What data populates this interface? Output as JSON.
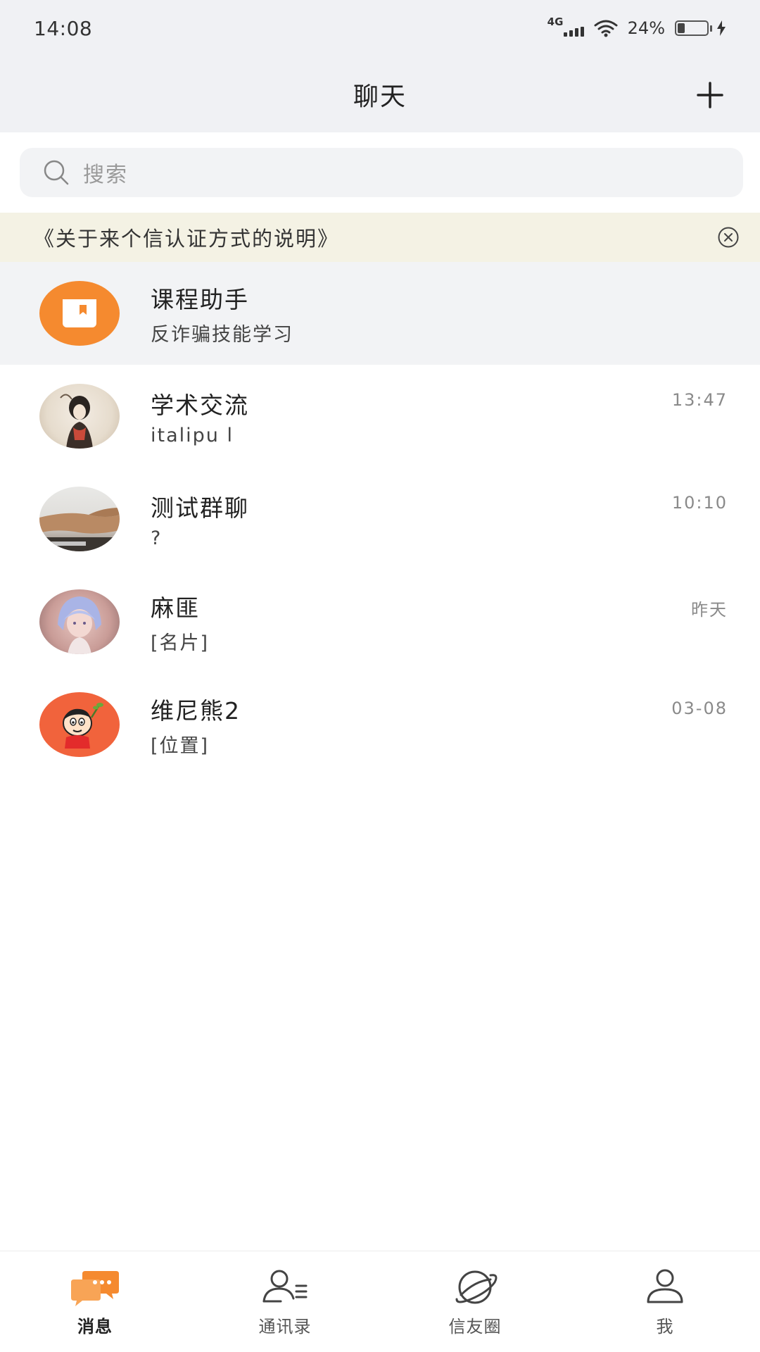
{
  "status_bar": {
    "time": "14:08",
    "network": "4G",
    "battery": "24%",
    "battery_level": 0.24
  },
  "header": {
    "title": "聊天",
    "add_icon": "plus-icon"
  },
  "search": {
    "placeholder": "搜索",
    "icon": "search-icon"
  },
  "notice": {
    "text": "《关于来个信认证方式的说明》",
    "close_icon": "close-circle-icon"
  },
  "chats": [
    {
      "name": "课程助手",
      "preview": "反诈骗技能学习",
      "time": "",
      "pinned": true,
      "avatar": "orange-book-icon"
    },
    {
      "name": "学术交流",
      "preview": "italipu l",
      "time": "13:47",
      "avatar": "ink-painting-girl-avatar"
    },
    {
      "name": "测试群聊",
      "preview": "?",
      "time": "10:10",
      "avatar": "arm-photo-avatar"
    },
    {
      "name": "麻匪",
      "preview": "[名片]",
      "time": "昨天",
      "avatar": "blue-hair-cosplay-avatar"
    },
    {
      "name": "维尼熊2",
      "preview": "[位置]",
      "time": "03-08",
      "avatar": "cartoon-boy-avatar"
    }
  ],
  "bottom_nav": [
    {
      "label": "消息",
      "icon": "chat-bubble-icon",
      "active": true
    },
    {
      "label": "通讯录",
      "icon": "contacts-icon",
      "active": false
    },
    {
      "label": "信友圈",
      "icon": "planet-icon",
      "active": false
    },
    {
      "label": "我",
      "icon": "person-icon",
      "active": false
    }
  ],
  "colors": {
    "accent": "#f58a2f",
    "header_bg": "#f0f1f4",
    "notice_bg": "#f4f2e4",
    "pinned_bg": "#f2f3f5"
  }
}
